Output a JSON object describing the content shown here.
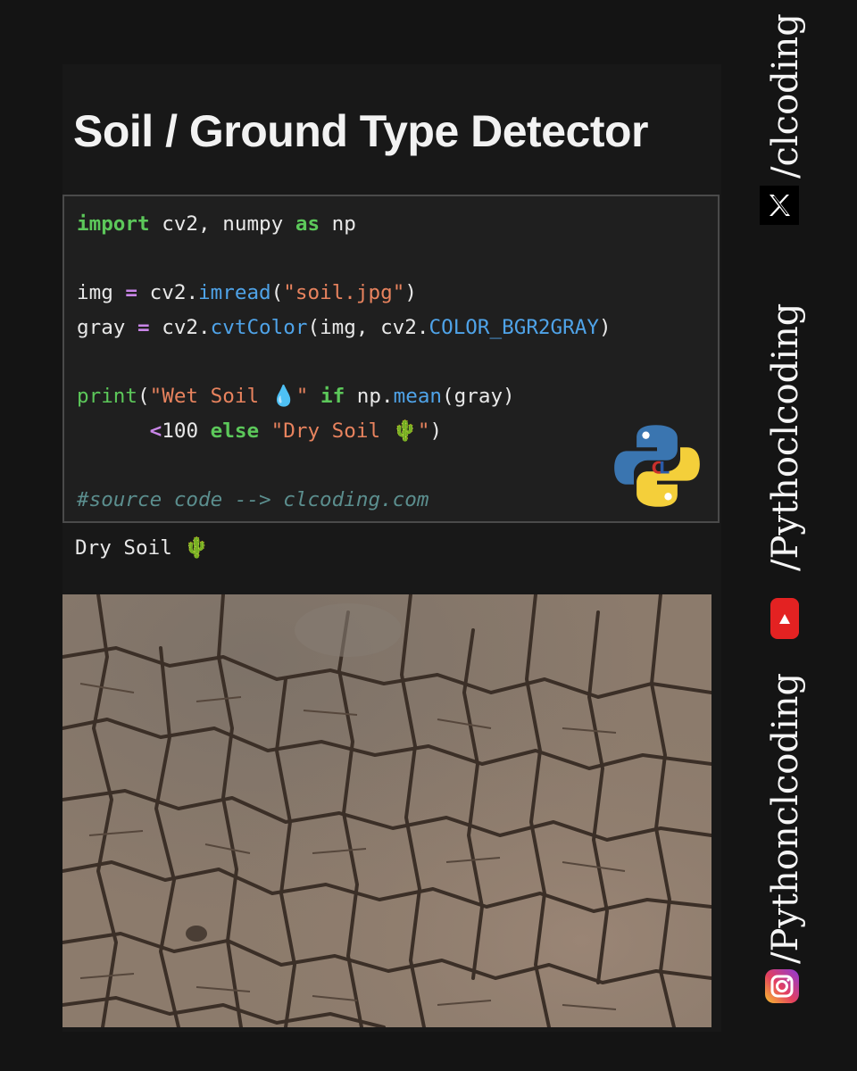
{
  "title": "Soil / Ground Type Detector",
  "code": {
    "line1": {
      "import": "import",
      "mod": " cv2, numpy ",
      "as": "as",
      "alias": " np"
    },
    "line3": {
      "a": "img ",
      "eq": "=",
      "b": " cv2.",
      "fn": "imread",
      "p1": "(",
      "str": "\"soil.jpg\"",
      "p2": ")"
    },
    "line4": {
      "a": "gray ",
      "eq": "=",
      "b": " cv2.",
      "fn": "cvtColor",
      "args": "(img, cv2.",
      "const": "COLOR_BGR2GRAY",
      "p2": ")"
    },
    "line6": {
      "print": "print",
      "p1": "(",
      "str1": "\"Wet Soil 💧\"",
      "if": " if",
      "np": " np.",
      "mean": "mean",
      "args": "(gray)"
    },
    "line7": {
      "indent": "      ",
      "lt": "<",
      "num": "100",
      "else": " else",
      "str2": " \"Dry Soil 🌵\"",
      "p2": ")"
    },
    "comment": "#source code --> clcoding.com"
  },
  "output": "Dry Soil 🌵",
  "social": {
    "x_handle": "/clcoding",
    "youtube_handle": "/Pythoclcoding",
    "instagram_handle": "/Pythonclcoding"
  },
  "icons": {
    "x": "x-logo-icon",
    "youtube": "youtube-icon",
    "instagram": "instagram-icon",
    "python": "python-logo-icon"
  },
  "colors": {
    "keyword": "#5cc85a",
    "function": "#4fa3e8",
    "string": "#e8835e",
    "operator": "#c986e8",
    "comment": "#5b8e8e",
    "youtube_red": "#e32222"
  }
}
